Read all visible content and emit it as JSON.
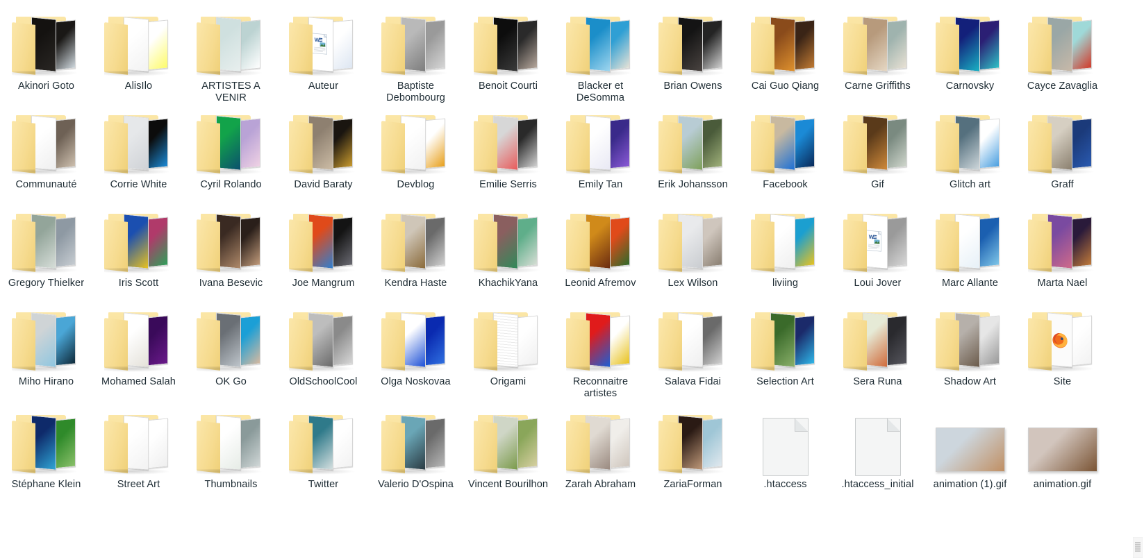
{
  "window": {
    "title": "Folder contents grid",
    "icon_view": "large-icons",
    "columns": 12,
    "rows": 5
  },
  "colors": {
    "folder_light": "#fbe6a6",
    "folder_mid": "#f7dd93",
    "folder_dark": "#efd078",
    "label_text": "#1d2b33",
    "background": "#ffffff",
    "file_fill": "#f4f5f5",
    "file_border": "#c9cccd"
  },
  "items": [
    {
      "label": "Akinori Goto",
      "type": "folder",
      "icon": "folder-icon",
      "preview": [
        "#141210",
        "#2a2724"
      ],
      "thumb": [
        "#1a1816",
        "#cfd8de"
      ]
    },
    {
      "label": "AlisIlo",
      "type": "folder",
      "icon": "folder-icon",
      "preview": [
        "#ffffff",
        "#f2f2f2"
      ],
      "thumb": [
        "#ffffff",
        "#fdfb6a"
      ]
    },
    {
      "label": "ARTISTES A VENIR",
      "type": "folder",
      "icon": "folder-icon",
      "preview": [
        "#cfe0df",
        "#e8efee"
      ],
      "thumb": [
        "#bcd3d2",
        "#ffffff"
      ]
    },
    {
      "label": "Auteur",
      "type": "folder-doc",
      "icon": "folder-word-doc-icon",
      "preview": [
        "#ffffff",
        "#eef2f7"
      ],
      "thumb": [
        "#ffffff",
        "#dde6f2"
      ]
    },
    {
      "label": "Baptiste Debombourg",
      "type": "folder",
      "icon": "folder-icon",
      "preview": [
        "#b9b9b9",
        "#7d7d7d"
      ],
      "thumb": [
        "#9a9a9a",
        "#d5d5d5"
      ]
    },
    {
      "label": "Benoit Courti",
      "type": "folder",
      "icon": "folder-icon",
      "preview": [
        "#0d0d0d",
        "#3b3b3b"
      ],
      "thumb": [
        "#2a2a2a",
        "#b6a79c"
      ]
    },
    {
      "label": "Blacker et DeSomma",
      "type": "folder",
      "icon": "folder-icon",
      "preview": [
        "#1b8ec9",
        "#9fd6ef"
      ],
      "thumb": [
        "#2f9fd4",
        "#e6e2d6"
      ]
    },
    {
      "label": "Brian Owens",
      "type": "folder",
      "icon": "folder-icon",
      "preview": [
        "#141414",
        "#4a4441"
      ],
      "thumb": [
        "#242424",
        "#cfcfcf"
      ]
    },
    {
      "label": "Cai Guo Qiang",
      "type": "folder",
      "icon": "folder-icon",
      "preview": [
        "#8a4b1b",
        "#e0922e"
      ],
      "thumb": [
        "#3a2416",
        "#c07a33"
      ]
    },
    {
      "label": "Carne Griffiths",
      "type": "folder",
      "icon": "folder-icon",
      "preview": [
        "#b79a7c",
        "#e6d8c4"
      ],
      "thumb": [
        "#9fb3ae",
        "#e8e1d4"
      ]
    },
    {
      "label": "Carnovsky",
      "type": "folder",
      "icon": "folder-icon",
      "preview": [
        "#13207a",
        "#19b2c4"
      ],
      "thumb": [
        "#2b1f74",
        "#2fc0c6"
      ]
    },
    {
      "label": "Cayce Zavaglia",
      "type": "folder",
      "icon": "folder-icon",
      "preview": [
        "#9aa7a6",
        "#c8b9a8"
      ],
      "thumb": [
        "#9fd9d8",
        "#d23a2a"
      ]
    },
    {
      "label": "Communauté",
      "type": "folder",
      "icon": "folder-icon",
      "preview": [
        "#ffffff",
        "#efefef"
      ],
      "thumb": [
        "#6e6155",
        "#cdbfae"
      ]
    },
    {
      "label": "Corrie White",
      "type": "folder",
      "icon": "folder-icon",
      "preview": [
        "#e6e8ea",
        "#cfd2d6"
      ],
      "thumb": [
        "#0c0c0c",
        "#1b8ad6"
      ]
    },
    {
      "label": "Cyril Rolando",
      "type": "folder",
      "icon": "folder-icon",
      "preview": [
        "#12a34a",
        "#0b4f6e"
      ],
      "thumb": [
        "#b9a3d6",
        "#efd1e4"
      ]
    },
    {
      "label": "David Baraty",
      "type": "folder",
      "icon": "folder-icon",
      "preview": [
        "#8e8070",
        "#cdbda6"
      ],
      "thumb": [
        "#1a1510",
        "#c89a2e"
      ]
    },
    {
      "label": "Devblog",
      "type": "folder",
      "icon": "folder-icon",
      "preview": [
        "#ffffff",
        "#f1f1f1"
      ],
      "thumb": [
        "#ffffff",
        "#e8a01c"
      ]
    },
    {
      "label": "Emilie Serris",
      "type": "folder",
      "icon": "folder-icon",
      "preview": [
        "#d7d7d7",
        "#e85a5a"
      ],
      "thumb": [
        "#2a2a2a",
        "#cfcfcf"
      ]
    },
    {
      "label": "Emily Tan",
      "type": "folder",
      "icon": "folder-icon",
      "preview": [
        "#ffffff",
        "#e9e9f4"
      ],
      "thumb": [
        "#3a2a8a",
        "#8a5ad6"
      ]
    },
    {
      "label": "Erik Johansson",
      "type": "folder",
      "icon": "folder-icon",
      "preview": [
        "#b8ccd4",
        "#7ea05a"
      ],
      "thumb": [
        "#4a5b3a",
        "#9fb07a"
      ]
    },
    {
      "label": "Facebook",
      "type": "folder",
      "icon": "folder-icon",
      "preview": [
        "#c8b9a0",
        "#1b6fd6"
      ],
      "thumb": [
        "#1b8ad6",
        "#0a2a5a"
      ]
    },
    {
      "label": "Gif",
      "type": "folder",
      "icon": "folder-icon",
      "preview": [
        "#5a3a1a",
        "#d08a3a"
      ],
      "thumb": [
        "#7a8a80",
        "#cfd6cc"
      ]
    },
    {
      "label": "Glitch art",
      "type": "folder",
      "icon": "folder-icon",
      "preview": [
        "#55707e",
        "#cfd8dc"
      ],
      "thumb": [
        "#ffffff",
        "#4a9fe0"
      ]
    },
    {
      "label": "Graff",
      "type": "folder",
      "icon": "folder-icon",
      "preview": [
        "#d6cfc2",
        "#8a7f6e"
      ],
      "thumb": [
        "#1b3a7a",
        "#2a5ab0"
      ]
    },
    {
      "label": "Gregory Thielker",
      "type": "folder",
      "icon": "folder-icon",
      "preview": [
        "#93a59a",
        "#d7ded9"
      ],
      "thumb": [
        "#8e99a3",
        "#c6ccd1"
      ]
    },
    {
      "label": "Iris Scott",
      "type": "folder",
      "icon": "folder-icon",
      "preview": [
        "#1b4fb0",
        "#e8c220"
      ],
      "thumb": [
        "#b03a6a",
        "#2f9f5a"
      ]
    },
    {
      "label": "Ivana Besevic",
      "type": "folder",
      "icon": "folder-icon",
      "preview": [
        "#3a2a22",
        "#b08a6a"
      ],
      "thumb": [
        "#2a1f1a",
        "#c09a7a"
      ]
    },
    {
      "label": "Joe Mangrum",
      "type": "folder",
      "icon": "folder-icon",
      "preview": [
        "#e04a1a",
        "#2f7fd0"
      ],
      "thumb": [
        "#141414",
        "#6a6a72"
      ]
    },
    {
      "label": "Kendra Haste",
      "type": "folder",
      "icon": "folder-icon",
      "preview": [
        "#cfc6b8",
        "#8a6a3a"
      ],
      "thumb": [
        "#6a6a6a",
        "#cfcfcf"
      ]
    },
    {
      "label": "KhachikYana",
      "type": "folder",
      "icon": "folder-icon",
      "preview": [
        "#8a5f5f",
        "#2f8a5a"
      ],
      "thumb": [
        "#5fae8a",
        "#d6ddd4"
      ]
    },
    {
      "label": "Leonid Afremov",
      "type": "folder",
      "icon": "folder-icon",
      "preview": [
        "#d08a1a",
        "#6a2a10"
      ],
      "thumb": [
        "#e04a1a",
        "#2f6a2a"
      ]
    },
    {
      "label": "Lex Wilson",
      "type": "folder",
      "icon": "folder-icon",
      "preview": [
        "#e9eaec",
        "#c9ccd0"
      ],
      "thumb": [
        "#cfc6bd",
        "#8a7f72"
      ]
    },
    {
      "label": "liviing",
      "type": "folder",
      "icon": "folder-icon",
      "preview": [
        "#ffffff",
        "#efefef"
      ],
      "thumb": [
        "#1b9fd0",
        "#e8c220"
      ]
    },
    {
      "label": "Loui Jover",
      "type": "folder-doc",
      "icon": "folder-word-doc-icon",
      "preview": [
        "#ffffff",
        "#eef2f7"
      ],
      "thumb": [
        "#9a9a9a",
        "#d6d6d6"
      ]
    },
    {
      "label": "Marc Allante",
      "type": "folder",
      "icon": "folder-icon",
      "preview": [
        "#ffffff",
        "#e6f0f7"
      ],
      "thumb": [
        "#1b5fb0",
        "#7fc6e8"
      ]
    },
    {
      "label": "Marta Nael",
      "type": "folder",
      "icon": "folder-icon",
      "preview": [
        "#7a4aa0",
        "#d06a8a"
      ],
      "thumb": [
        "#2a1a3a",
        "#c07a3a"
      ]
    },
    {
      "label": "Miho Hirano",
      "type": "folder",
      "icon": "folder-icon",
      "preview": [
        "#cfd4d6",
        "#8ec6e0"
      ],
      "thumb": [
        "#4aa6d6",
        "#0e2a3a"
      ]
    },
    {
      "label": "Mohamed Salah",
      "type": "folder",
      "icon": "folder-icon",
      "preview": [
        "#ffffff",
        "#e4e1d9"
      ],
      "thumb": [
        "#3a0a5a",
        "#6a1a8a"
      ]
    },
    {
      "label": "OK Go",
      "type": "folder",
      "icon": "folder-icon",
      "preview": [
        "#6a6f75",
        "#bfc6cc"
      ],
      "thumb": [
        "#1b9fd6",
        "#d6b9a0"
      ]
    },
    {
      "label": "OldSchoolCool",
      "type": "folder",
      "icon": "folder-icon",
      "preview": [
        "#bdbdbd",
        "#6a6a6a"
      ],
      "thumb": [
        "#8a8a8a",
        "#d6d6d6"
      ]
    },
    {
      "label": "Olga Noskovaa",
      "type": "folder",
      "icon": "folder-icon",
      "preview": [
        "#ffffff",
        "#1b4fd6"
      ],
      "thumb": [
        "#0a2ab0",
        "#2f6fe0"
      ]
    },
    {
      "label": "Origami",
      "type": "folder-plain",
      "icon": "folder-blank-pages-icon",
      "preview": [
        "#ffffff",
        "#f4f4f4"
      ],
      "thumb": [
        "#ffffff",
        "#f0f0f0"
      ]
    },
    {
      "label": "Reconnaitre artistes",
      "type": "folder",
      "icon": "folder-icon",
      "preview": [
        "#e01b1b",
        "#1b5fd6"
      ],
      "thumb": [
        "#ffffff",
        "#e8c220"
      ]
    },
    {
      "label": "Salava Fidai",
      "type": "folder",
      "icon": "folder-icon",
      "preview": [
        "#ffffff",
        "#efefef"
      ],
      "thumb": [
        "#6a6a6a",
        "#cfcfcf"
      ]
    },
    {
      "label": "Selection Art",
      "type": "folder",
      "icon": "folder-icon",
      "preview": [
        "#3a6a2a",
        "#8ab06a"
      ],
      "thumb": [
        "#1b2a6a",
        "#2fb6e8"
      ]
    },
    {
      "label": "Sera Runa",
      "type": "folder",
      "icon": "folder-icon",
      "preview": [
        "#e6ead6",
        "#d06a3a"
      ],
      "thumb": [
        "#2a2a2e",
        "#55555c"
      ]
    },
    {
      "label": "Shadow Art",
      "type": "folder",
      "icon": "folder-icon",
      "preview": [
        "#b6b0aa",
        "#6a5a4a"
      ],
      "thumb": [
        "#e6e6e6",
        "#9a9a9a"
      ]
    },
    {
      "label": "Site",
      "type": "folder-firefox",
      "icon": "folder-firefox-icon",
      "preview": [
        "#ffffff",
        "#f2f2f2"
      ],
      "thumb": [
        "#ffffff",
        "#f2f2f2"
      ]
    },
    {
      "label": "Stéphane Klein",
      "type": "folder",
      "icon": "folder-icon",
      "preview": [
        "#0e2a6a",
        "#2fa6d6"
      ],
      "thumb": [
        "#2f8a2a",
        "#8ac06a"
      ]
    },
    {
      "label": "Street Art",
      "type": "folder",
      "icon": "folder-icon",
      "preview": [
        "#ffffff",
        "#f2f2f2"
      ],
      "thumb": [
        "#ffffff",
        "#efefef"
      ]
    },
    {
      "label": "Thumbnails",
      "type": "folder",
      "icon": "folder-icon",
      "preview": [
        "#ffffff",
        "#e6ece6"
      ],
      "thumb": [
        "#8a9a9a",
        "#cfd6d6"
      ]
    },
    {
      "label": "Twitter",
      "type": "folder",
      "icon": "folder-icon",
      "preview": [
        "#2f7a8a",
        "#d6e0e0"
      ],
      "thumb": [
        "#ffffff",
        "#f2f2f2"
      ]
    },
    {
      "label": "Valerio D'Ospina",
      "type": "folder",
      "icon": "folder-icon",
      "preview": [
        "#6aa6b6",
        "#2a3a42"
      ],
      "thumb": [
        "#6a6a6a",
        "#b6b6b6"
      ]
    },
    {
      "label": "Vincent Bourilhon",
      "type": "folder",
      "icon": "folder-icon",
      "preview": [
        "#cfd6c6",
        "#7a9a4a"
      ],
      "thumb": [
        "#8aa65a",
        "#d6cfa0"
      ]
    },
    {
      "label": "Zarah Abraham",
      "type": "folder",
      "icon": "folder-icon",
      "preview": [
        "#e0dad2",
        "#9a8a80"
      ],
      "thumb": [
        "#f0eeea",
        "#cfc6bd"
      ]
    },
    {
      "label": "ZariaForman",
      "type": "folder",
      "icon": "folder-icon",
      "preview": [
        "#2a1a14",
        "#c09a7a"
      ],
      "thumb": [
        "#9fc6d6",
        "#e0e8ee"
      ]
    },
    {
      "label": ".htaccess",
      "type": "file",
      "icon": "blank-file-icon",
      "preview": [
        "#f4f5f5",
        "#f4f5f5"
      ],
      "thumb": [
        "#f4f5f5",
        "#f4f5f5"
      ]
    },
    {
      "label": ".htaccess_initial",
      "type": "file",
      "icon": "blank-file-icon",
      "preview": [
        "#f4f5f5",
        "#f4f5f5"
      ],
      "thumb": [
        "#f4f5f5",
        "#f4f5f5"
      ]
    },
    {
      "label": "animation (1).gif",
      "type": "image",
      "icon": "gif-thumbnail-icon",
      "preview": [
        "#cdd6dd",
        "#b9895f"
      ],
      "thumb": [
        "#cdd6dd",
        "#c08f63"
      ]
    },
    {
      "label": "animation.gif",
      "type": "image",
      "icon": "gif-thumbnail-icon",
      "preview": [
        "#cfc2bb",
        "#8a6340"
      ],
      "thumb": [
        "#d2c5bd",
        "#7a5434"
      ]
    }
  ]
}
